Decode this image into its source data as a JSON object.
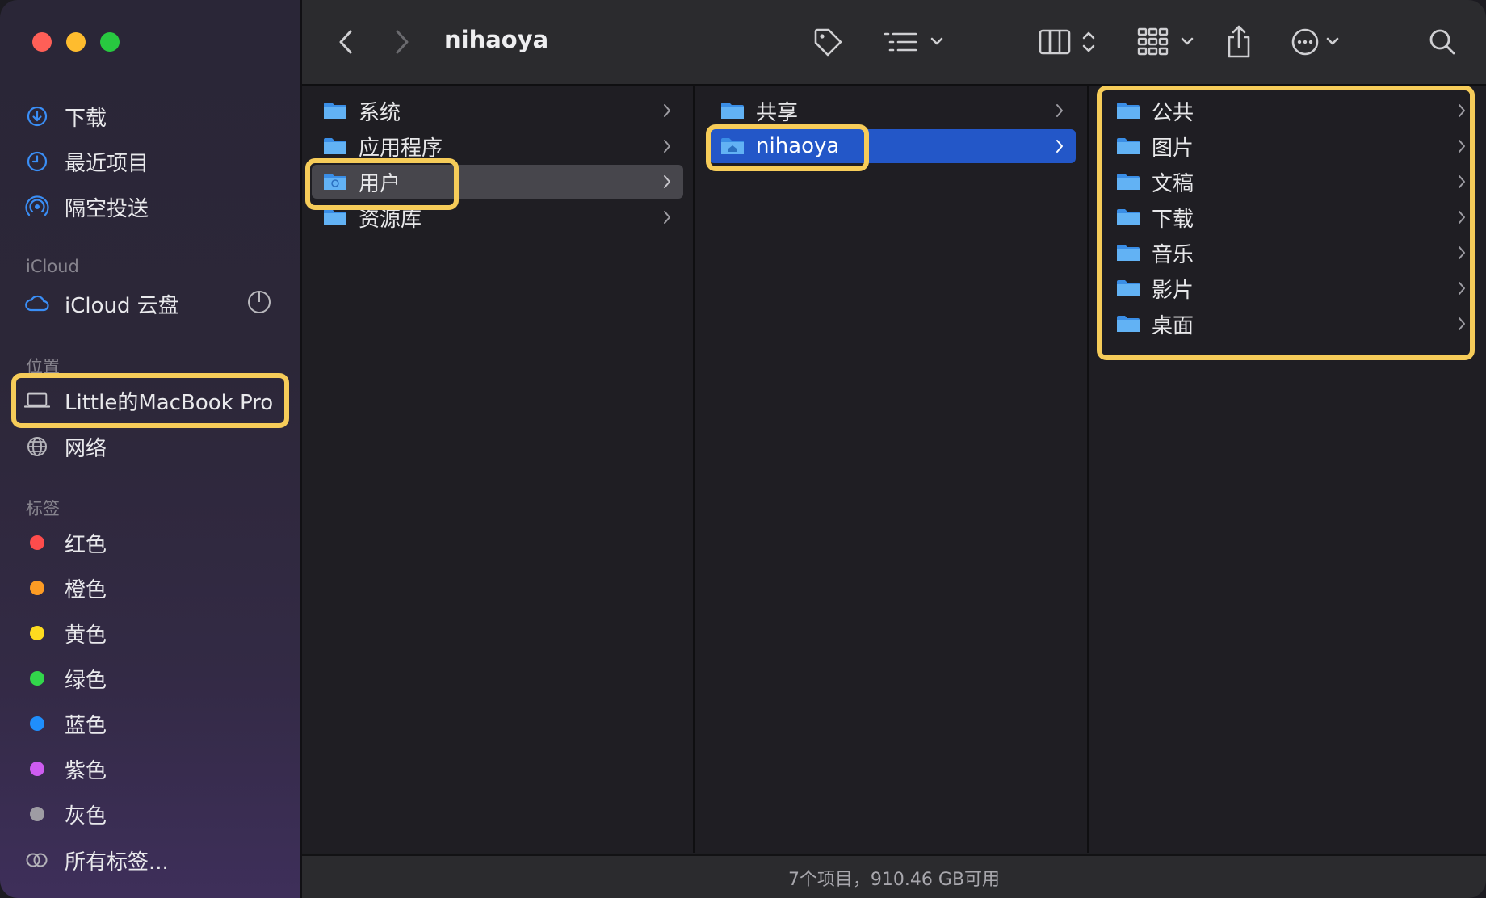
{
  "window": {
    "title": "nihaoya"
  },
  "sidebar": {
    "favorites": [
      {
        "label": "下载",
        "icon": "download-circle-icon"
      },
      {
        "label": "最近项目",
        "icon": "clock-icon"
      },
      {
        "label": "隔空投送",
        "icon": "airdrop-icon"
      }
    ],
    "icloud_header": "iCloud",
    "icloud_items": [
      {
        "label": "iCloud 云盘",
        "icon": "cloud-icon"
      }
    ],
    "locations_header": "位置",
    "locations": [
      {
        "label": "Little的MacBook Pro",
        "icon": "laptop-icon"
      },
      {
        "label": "网络",
        "icon": "globe-icon"
      }
    ],
    "tags_header": "标签",
    "tags": [
      {
        "label": "红色",
        "color": "#fe4c4c"
      },
      {
        "label": "橙色",
        "color": "#fd9b24"
      },
      {
        "label": "黄色",
        "color": "#fddb1f"
      },
      {
        "label": "绿色",
        "color": "#32d64b"
      },
      {
        "label": "蓝色",
        "color": "#1f8efc"
      },
      {
        "label": "紫色",
        "color": "#cd5cf0"
      },
      {
        "label": "灰色",
        "color": "#9e9ca3"
      }
    ],
    "all_tags": "所有标签..."
  },
  "columns": {
    "col1": [
      "系统",
      "应用程序",
      "用户",
      "资源库"
    ],
    "col2": [
      "共享",
      "nihaoya"
    ],
    "col3": [
      "公共",
      "图片",
      "文稿",
      "下载",
      "音乐",
      "影片",
      "桌面"
    ]
  },
  "status": "7个项目，910.46 GB可用",
  "colors": {
    "accent": "#2357c8",
    "highlight": "#f6cc59"
  }
}
